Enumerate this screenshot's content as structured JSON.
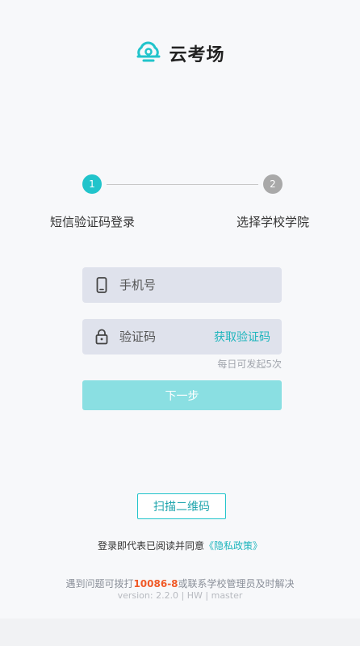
{
  "app": {
    "name": "云考场",
    "brand_color": "#21c4cb"
  },
  "steps": [
    {
      "number": "1",
      "label": "短信验证码登录",
      "state": "active"
    },
    {
      "number": "2",
      "label": "选择学校学院",
      "state": "inactive"
    }
  ],
  "form": {
    "phone_placeholder": "手机号",
    "code_placeholder": "验证码",
    "get_code_label": "获取验证码",
    "daily_limit_hint": "每日可发起5次",
    "next_label": "下一步"
  },
  "scan_label": "扫描二维码",
  "agreement": {
    "text": "登录即代表已阅读并同意",
    "policy_link": "《隐私政策》"
  },
  "contact": {
    "prefix": "遇到问题可拨打",
    "phone": "10086-8",
    "suffix": "或联系学校管理员及时解决"
  },
  "version": "version: 2.2.0 | HW | master"
}
